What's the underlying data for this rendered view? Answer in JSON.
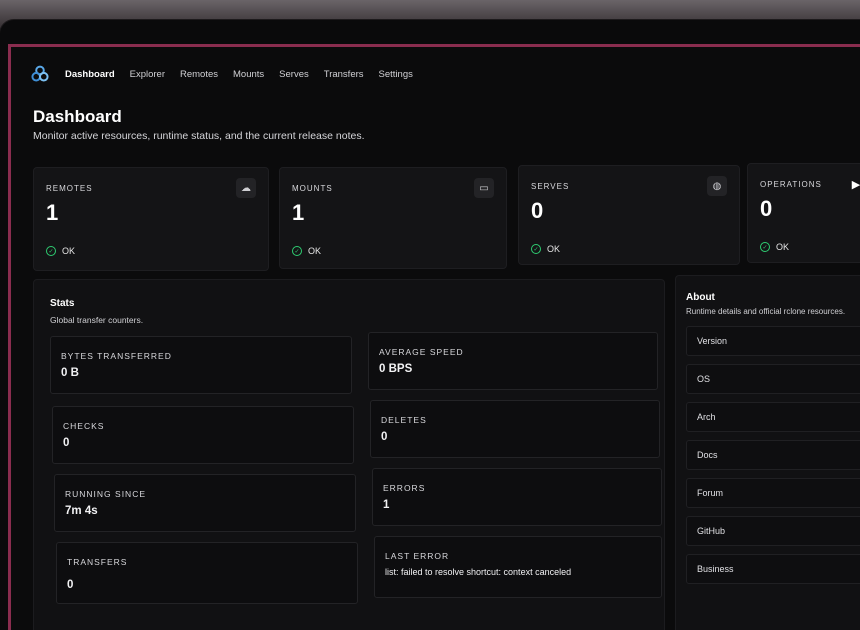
{
  "nav": {
    "items": [
      {
        "label": "Dashboard",
        "active": true
      },
      {
        "label": "Explorer",
        "active": false
      },
      {
        "label": "Remotes",
        "active": false
      },
      {
        "label": "Mounts",
        "active": false
      },
      {
        "label": "Serves",
        "active": false
      },
      {
        "label": "Transfers",
        "active": false
      },
      {
        "label": "Settings",
        "active": false
      }
    ]
  },
  "header": {
    "title": "Dashboard",
    "subtitle": "Monitor active resources, runtime status, and the current release notes."
  },
  "cards": [
    {
      "label": "REMOTES",
      "value": "1",
      "status": "OK",
      "icon": "cloud-icon"
    },
    {
      "label": "MOUNTS",
      "value": "1",
      "status": "OK",
      "icon": "drive-icon"
    },
    {
      "label": "SERVES",
      "value": "0",
      "status": "OK",
      "icon": "globe-icon"
    },
    {
      "label": "OPERATIONS",
      "value": "0",
      "status": "OK",
      "icon": "play-icon"
    }
  ],
  "stats": {
    "title": "Stats",
    "subtitle": "Global transfer counters.",
    "bytes_label": "BYTES TRANSFERRED",
    "bytes_value": "0 B",
    "speed_label": "AVERAGE SPEED",
    "speed_value": "0 BPS",
    "checks_label": "CHECKS",
    "checks_value": "0",
    "deletes_label": "DELETES",
    "deletes_value": "0",
    "running_label": "RUNNING SINCE",
    "running_value": "7m 4s",
    "errors_label": "ERRORS",
    "errors_value": "1",
    "transfers_label": "TRANSFERS",
    "transfers_value": "0",
    "last_error_label": "LAST ERROR",
    "last_error_value": "list: failed to resolve shortcut: context canceled"
  },
  "about": {
    "title": "About",
    "subtitle": "Runtime details and official rclone resources.",
    "items": [
      "Version",
      "OS",
      "Arch",
      "Docs",
      "Forum",
      "GitHub",
      "Business"
    ]
  },
  "colors": {
    "accent_frame": "#8a2d4f",
    "ok": "#2ecc71",
    "logo": "#5aa8e8"
  }
}
